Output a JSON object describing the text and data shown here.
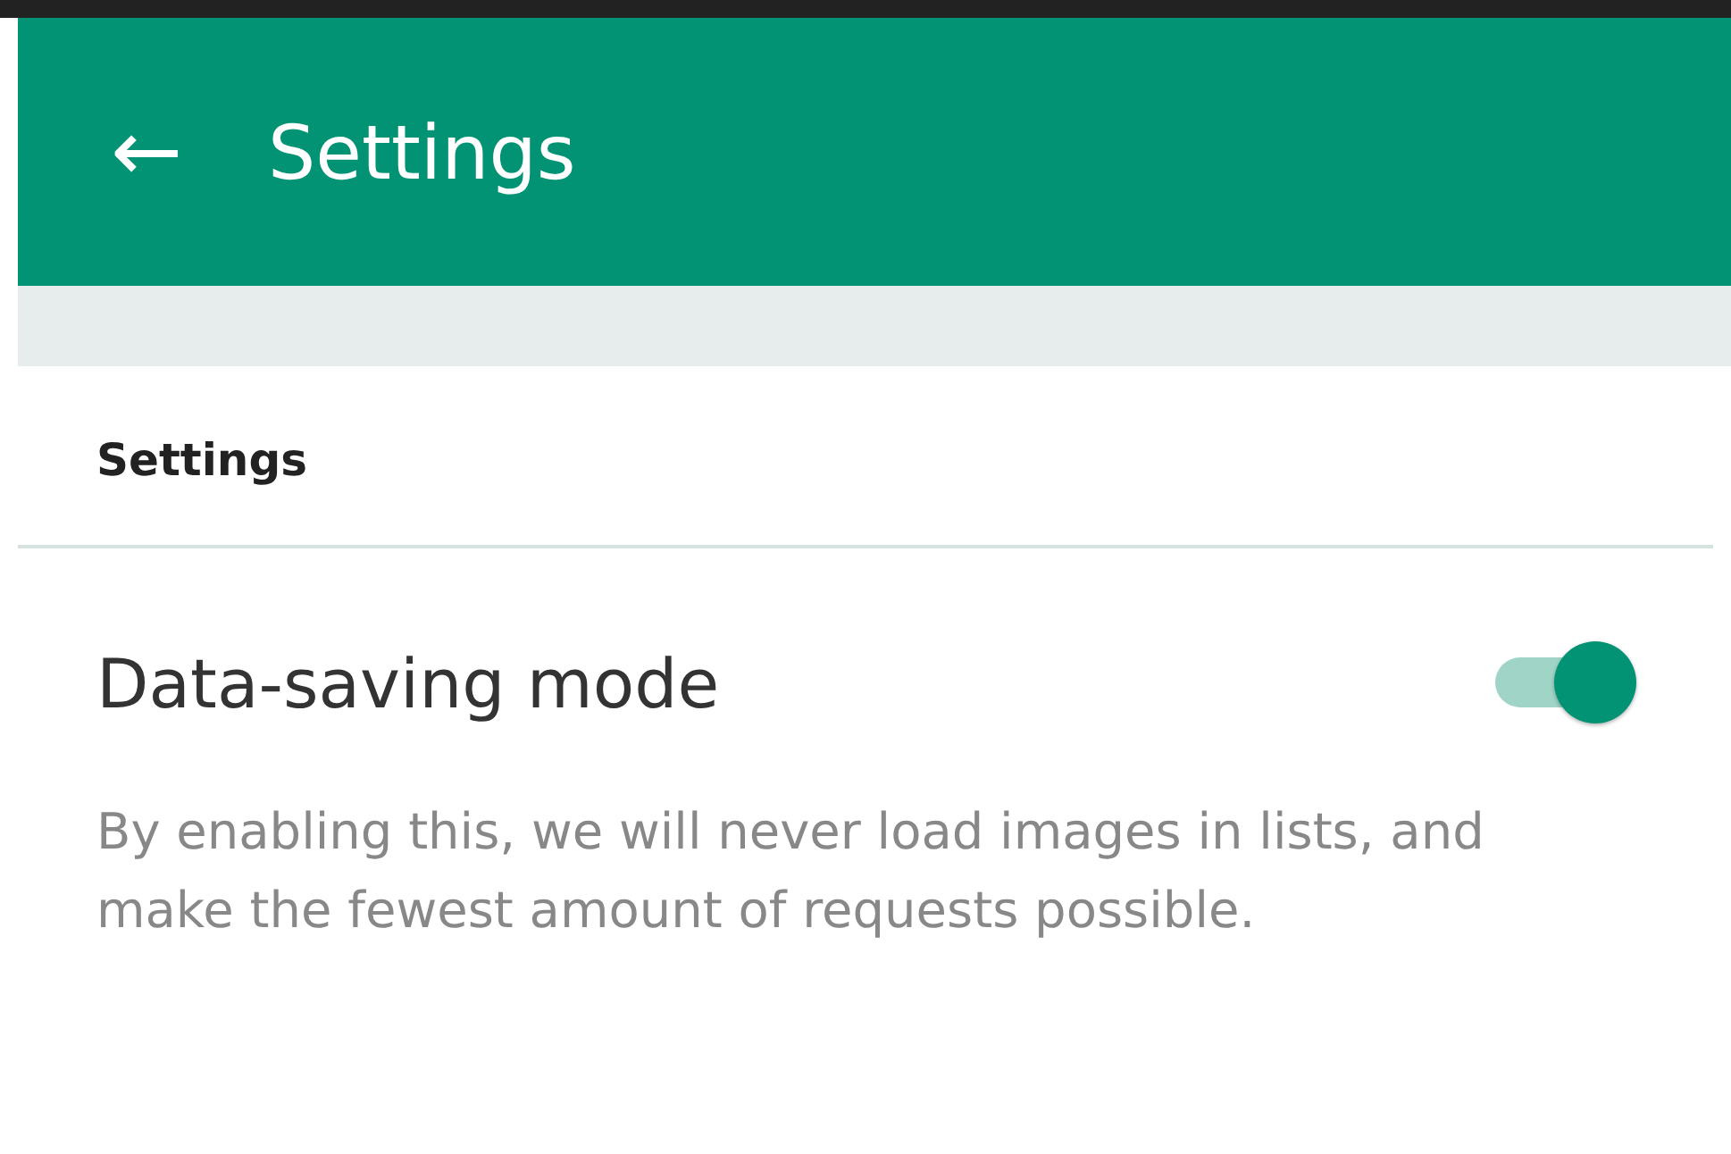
{
  "app_bar": {
    "back_icon": "←",
    "title": "Settings"
  },
  "section": {
    "header": "Settings"
  },
  "preferences": [
    {
      "kind": "switch",
      "title": "Data-saving mode",
      "on": true,
      "summary": "By enabling this, we will never load images in lists, and make the fewest amount of requests possible."
    }
  ]
}
